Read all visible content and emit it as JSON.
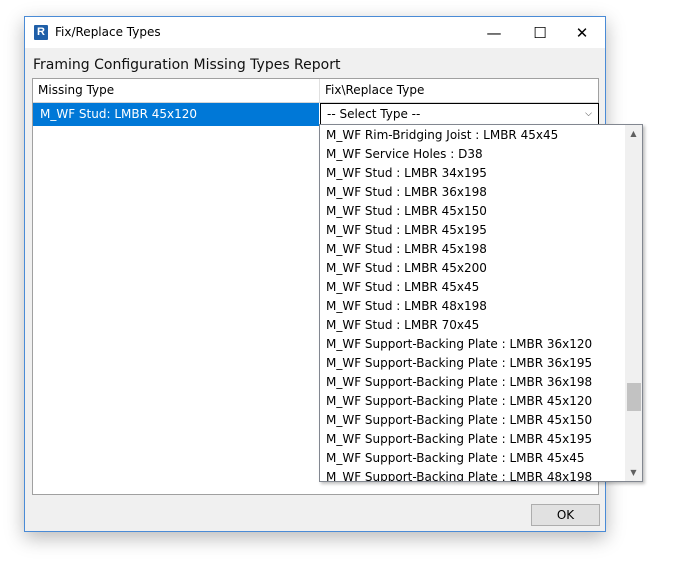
{
  "window": {
    "title": "Fix/Replace Types",
    "app_icon_letter": "R",
    "min_glyph": "—",
    "max_glyph": "☐",
    "close_glyph": "✕"
  },
  "heading": "Framing Configuration Missing Types Report",
  "grid": {
    "columns": [
      "Missing Type",
      "Fix\\Replace Type"
    ],
    "rows": [
      {
        "missing_type": "M_WF Stud: LMBR 45x120",
        "replace_type": "-- Select Type --"
      }
    ]
  },
  "dropdown": {
    "items": [
      "M_WF Rim-Bridging Joist : LMBR 45x45",
      "M_WF Service Holes : D38",
      "M_WF Stud : LMBR 34x195",
      "M_WF Stud : LMBR 36x198",
      "M_WF Stud : LMBR 45x150",
      "M_WF Stud : LMBR 45x195",
      "M_WF Stud : LMBR 45x198",
      "M_WF Stud : LMBR 45x200",
      "M_WF Stud : LMBR 45x45",
      "M_WF Stud : LMBR 48x198",
      "M_WF Stud : LMBR 70x45",
      "M_WF Support-Backing Plate : LMBR 36x120",
      "M_WF Support-Backing Plate : LMBR 36x195",
      "M_WF Support-Backing Plate : LMBR 36x198",
      "M_WF Support-Backing Plate : LMBR 45x120",
      "M_WF Support-Backing Plate : LMBR 45x150",
      "M_WF Support-Backing Plate : LMBR 45x195",
      "M_WF Support-Backing Plate : LMBR 45x45",
      "M_WF Support-Backing Plate : LMBR 48x198"
    ]
  },
  "ok_label": "OK",
  "colors": {
    "selection": "#0078d7",
    "window_border": "#4a8bd6"
  }
}
